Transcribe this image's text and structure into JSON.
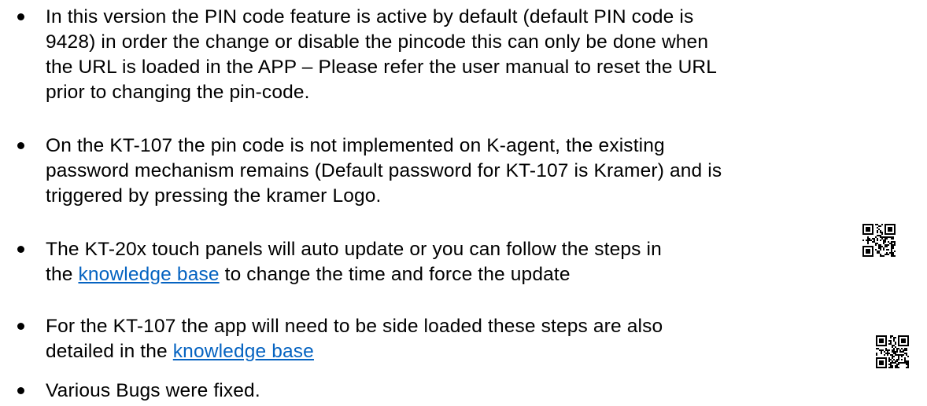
{
  "bullets": [
    {
      "lines": [
        "In this version the PIN code feature is active by default (default PIN code is",
        "9428) in order the change or disable the pincode this can only be done when",
        "the URL is loaded in the APP – Please refer the user manual to reset the URL",
        "prior to changing the pin-code."
      ]
    },
    {
      "lines": [
        "On the KT-107 the pin code is not implemented on K-agent, the existing",
        "password mechanism remains (Default password for KT-107 is Kramer) and is",
        "triggered by pressing the kramer Logo."
      ]
    },
    {
      "line1": "The KT-20x touch panels will auto update or you can follow the steps in",
      "line2_prefix": "the ",
      "link_text": "knowledge base",
      "line2_suffix": " to change the time and force the update",
      "qr_icon": "qr-code-icon"
    },
    {
      "line1": "For the KT-107 the app will need to be side loaded these steps are also",
      "line2_prefix": "detailed in the ",
      "link_text": "knowledge base",
      "line2_suffix": "",
      "qr_icon": "qr-code-icon"
    },
    {
      "lines": [
        "Various Bugs were fixed."
      ]
    }
  ],
  "colors": {
    "text": "#000000",
    "link": "#0563c1"
  }
}
